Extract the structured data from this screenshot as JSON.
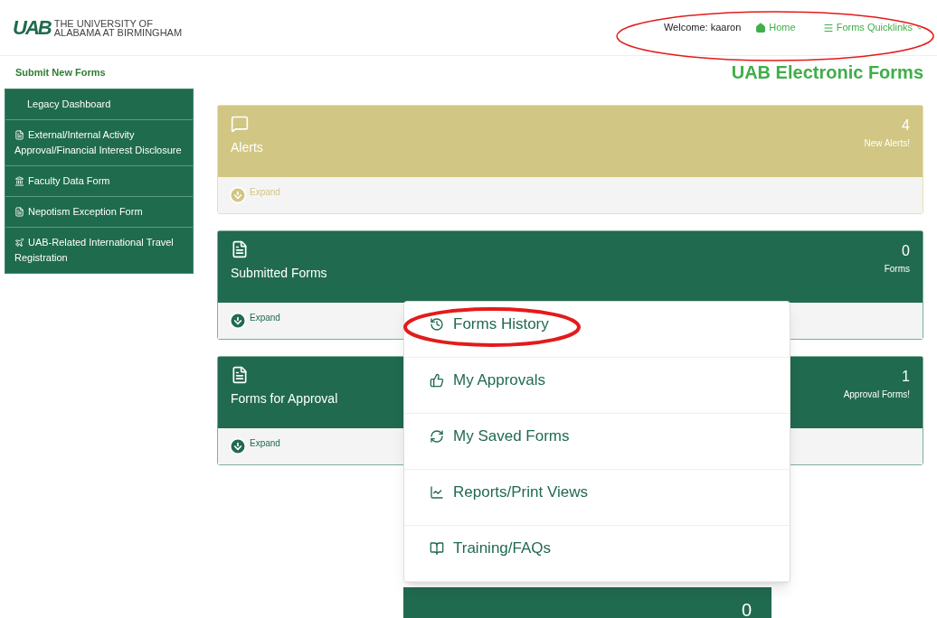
{
  "header": {
    "logo_mark": "UAB",
    "logo_line_1": "THE UNIVERSITY OF",
    "logo_line_2": "ALABAMA AT BIRMINGHAM",
    "welcome": "Welcome: kaaron",
    "home": "Home",
    "quicklinks": "Forms Quicklinks",
    "page_title": "UAB Electronic Forms"
  },
  "sidebar": {
    "heading": "Submit New Forms",
    "items": [
      {
        "label": "Legacy Dashboard",
        "kind": "plain"
      },
      {
        "label": "External/Internal Activity Approval/Financial Interest Disclosure",
        "kind": "file"
      },
      {
        "label": "Faculty Data Form",
        "kind": "bank"
      },
      {
        "label": "Nepotism Exception Form",
        "kind": "file"
      },
      {
        "label": "UAB-Related International Travel Registration",
        "kind": "plane"
      }
    ]
  },
  "panels": [
    {
      "kind": "alerts",
      "title": "Alerts",
      "count": "4",
      "count_label": "New Alerts!",
      "expand": "Expand"
    },
    {
      "kind": "forms",
      "title": "Submitted Forms",
      "count": "0",
      "count_label": "Forms",
      "expand": "Expand"
    },
    {
      "kind": "forms",
      "title": "Forms for Approval",
      "count": "1",
      "count_label": "Approval Forms!",
      "expand": "Expand"
    }
  ],
  "hidden_panel": {
    "count": "0"
  },
  "dropdown": {
    "items": [
      {
        "label": "Forms History",
        "kind": "history"
      },
      {
        "label": "My Approvals",
        "kind": "approvals"
      },
      {
        "label": "My Saved Forms",
        "kind": "saved"
      },
      {
        "label": "Reports/Print Views",
        "kind": "reports"
      },
      {
        "label": "Training/FAQs",
        "kind": "training"
      }
    ]
  },
  "annotations": [
    {
      "kind": "ellipse"
    },
    {
      "kind": "ellipse"
    }
  ]
}
